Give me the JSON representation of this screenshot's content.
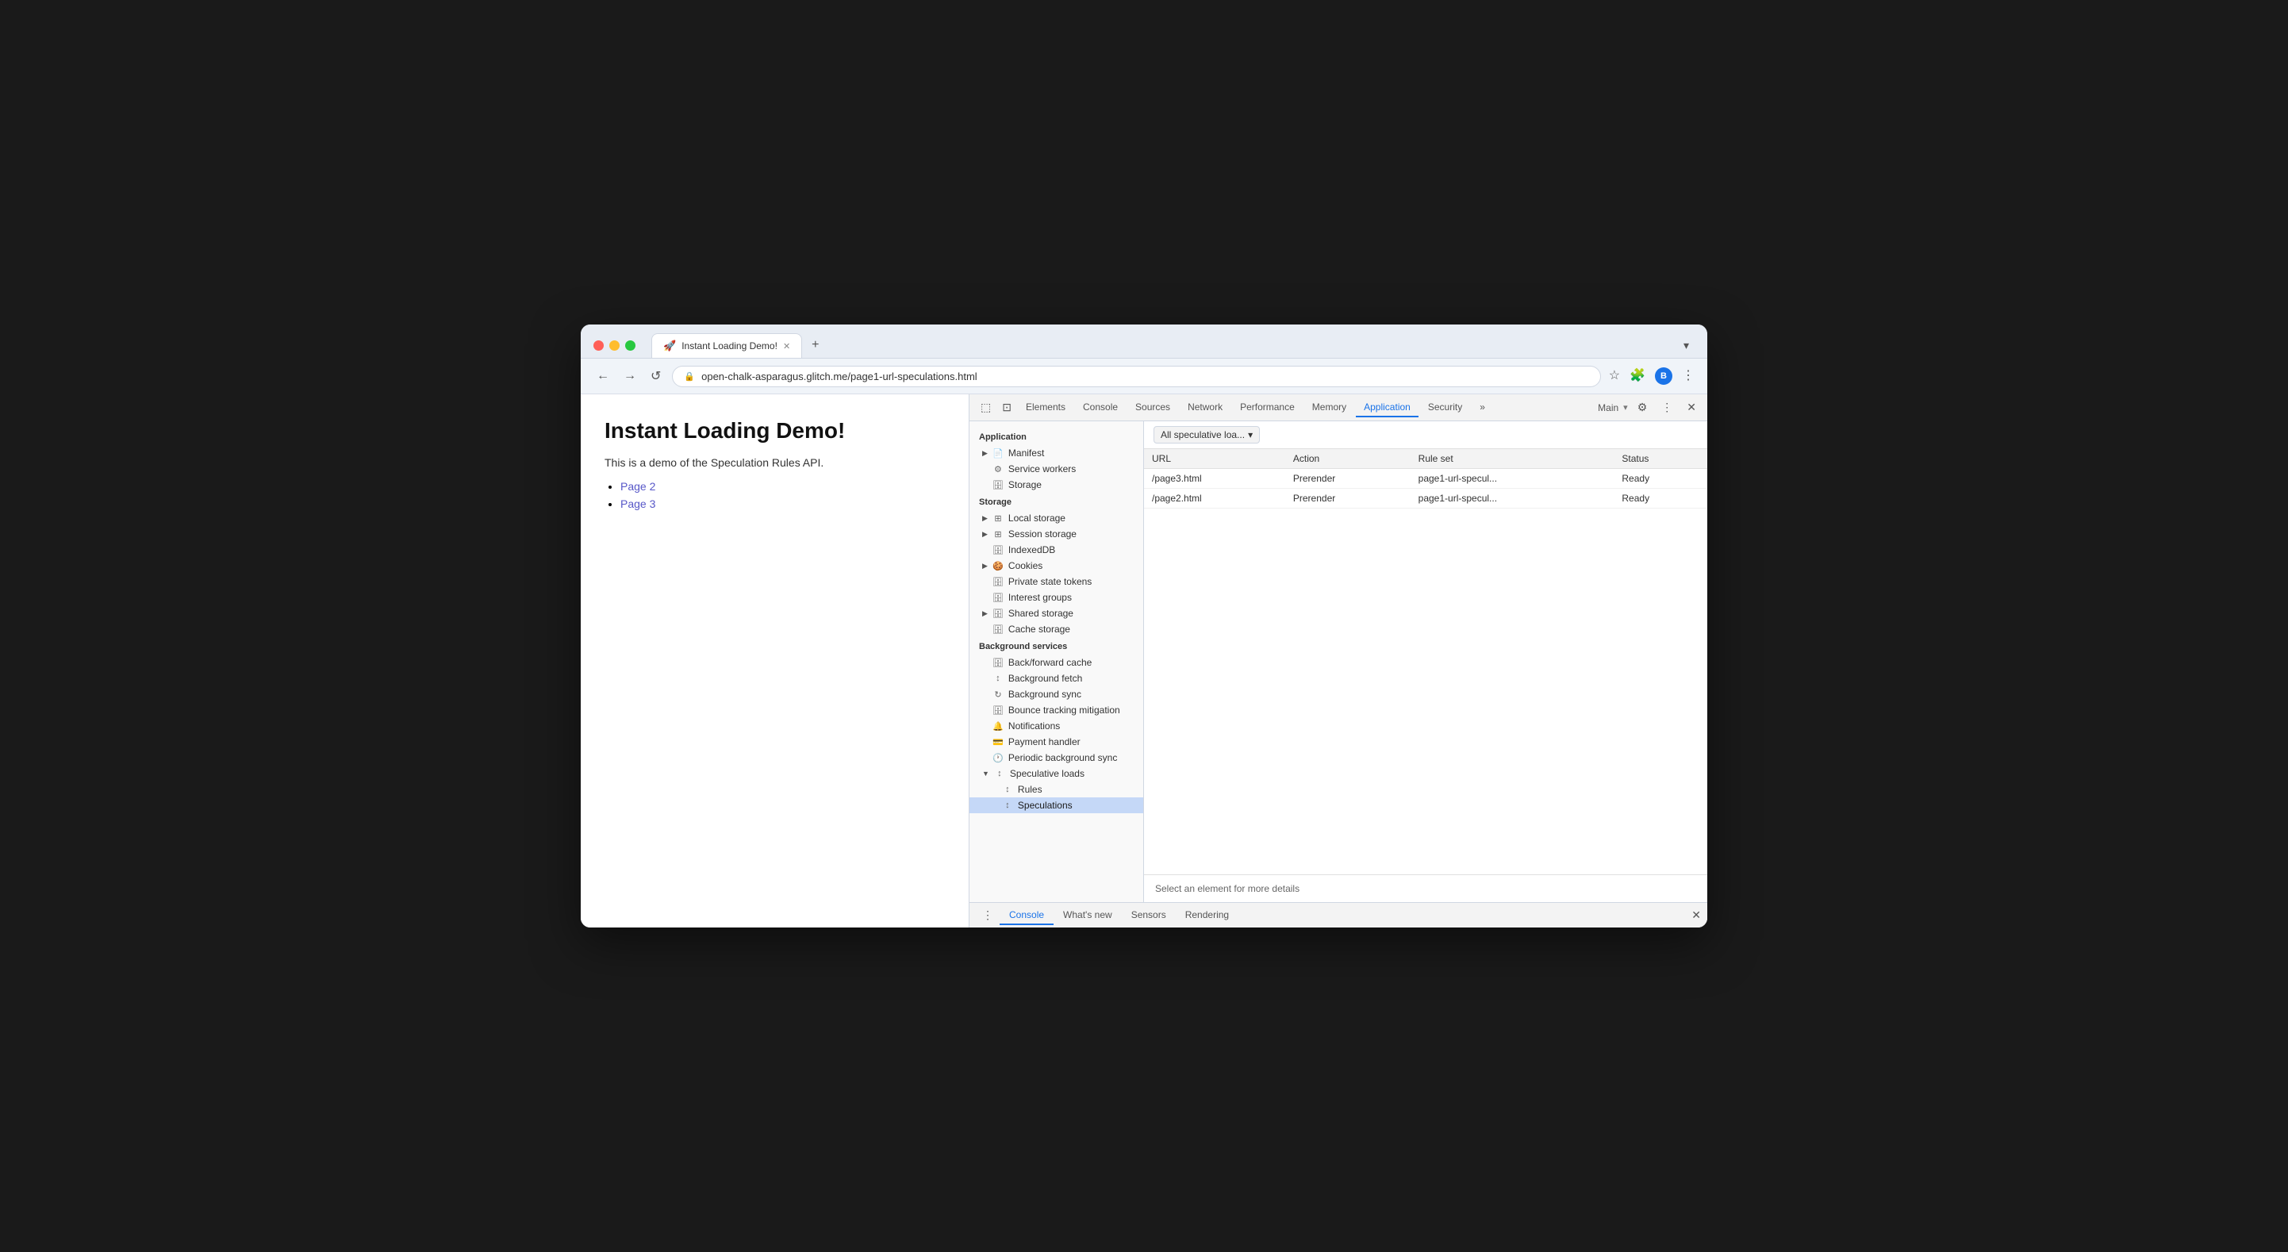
{
  "browser": {
    "tab_title": "Instant Loading Demo!",
    "tab_favicon": "🚀",
    "tab_close": "✕",
    "new_tab": "+",
    "dropdown": "▾"
  },
  "navbar": {
    "back": "←",
    "forward": "→",
    "refresh": "↺",
    "address": "open-chalk-asparagus.glitch.me/page1-url-speculations.html",
    "bookmark": "☆",
    "extensions": "🧩",
    "account": "B",
    "menu": "⋮"
  },
  "webpage": {
    "title": "Instant Loading Demo!",
    "description": "This is a demo of the Speculation Rules API.",
    "links": [
      "Page 2",
      "Page 3"
    ]
  },
  "devtools": {
    "toolbar": {
      "inspect": "⬚",
      "device": "📱",
      "tabs": [
        "Elements",
        "Console",
        "Sources",
        "Network",
        "Performance",
        "Memory",
        "Application",
        "Security",
        "»"
      ],
      "active_tab": "Application",
      "context": "Main",
      "settings": "⚙",
      "more": "⋮",
      "close": "✕"
    },
    "sidebar": {
      "section_application": "Application",
      "items_app": [
        {
          "label": "Manifest",
          "icon": "📄",
          "arrow": "▶",
          "indent": 1
        },
        {
          "label": "Service workers",
          "icon": "⚙",
          "arrow": "",
          "indent": 1
        },
        {
          "label": "Storage",
          "icon": "🗄",
          "arrow": "",
          "indent": 1
        }
      ],
      "section_storage": "Storage",
      "items_storage": [
        {
          "label": "Local storage",
          "icon": "⊞",
          "arrow": "▶",
          "indent": 1
        },
        {
          "label": "Session storage",
          "icon": "⊞",
          "arrow": "▶",
          "indent": 1
        },
        {
          "label": "IndexedDB",
          "icon": "🗄",
          "arrow": "",
          "indent": 1
        },
        {
          "label": "Cookies",
          "icon": "🍪",
          "arrow": "▶",
          "indent": 1
        },
        {
          "label": "Private state tokens",
          "icon": "🗄",
          "arrow": "",
          "indent": 1
        },
        {
          "label": "Interest groups",
          "icon": "🗄",
          "arrow": "",
          "indent": 1
        },
        {
          "label": "Shared storage",
          "icon": "🗄",
          "arrow": "▶",
          "indent": 1
        },
        {
          "label": "Cache storage",
          "icon": "🗄",
          "arrow": "",
          "indent": 1
        }
      ],
      "section_bg": "Background services",
      "items_bg": [
        {
          "label": "Back/forward cache",
          "icon": "🗄",
          "arrow": "",
          "indent": 1
        },
        {
          "label": "Background fetch",
          "icon": "↕",
          "arrow": "",
          "indent": 1
        },
        {
          "label": "Background sync",
          "icon": "↻",
          "arrow": "",
          "indent": 1
        },
        {
          "label": "Bounce tracking mitigation",
          "icon": "🗄",
          "arrow": "",
          "indent": 1
        },
        {
          "label": "Notifications",
          "icon": "🔔",
          "arrow": "",
          "indent": 1
        },
        {
          "label": "Payment handler",
          "icon": "💳",
          "arrow": "",
          "indent": 1
        },
        {
          "label": "Periodic background sync",
          "icon": "🕐",
          "arrow": "",
          "indent": 1
        },
        {
          "label": "Speculative loads",
          "icon": "↕",
          "arrow": "▼",
          "indent": 1
        },
        {
          "label": "Rules",
          "icon": "↕",
          "arrow": "",
          "indent": 2
        },
        {
          "label": "Speculations",
          "icon": "↕",
          "arrow": "",
          "indent": 2,
          "active": true
        }
      ]
    },
    "panel": {
      "filter_label": "All speculative loa...",
      "table_headers": [
        "URL",
        "Action",
        "Rule set",
        "Status"
      ],
      "rows": [
        {
          "url": "/page3.html",
          "action": "Prerender",
          "ruleset": "page1-url-specul...",
          "status": "Ready"
        },
        {
          "url": "/page2.html",
          "action": "Prerender",
          "ruleset": "page1-url-specul...",
          "status": "Ready"
        }
      ],
      "detail_msg": "Select an element for more details"
    },
    "console_bar": {
      "tabs": [
        "Console",
        "What's new",
        "Sensors",
        "Rendering"
      ],
      "active": "Console",
      "close": "✕"
    }
  }
}
